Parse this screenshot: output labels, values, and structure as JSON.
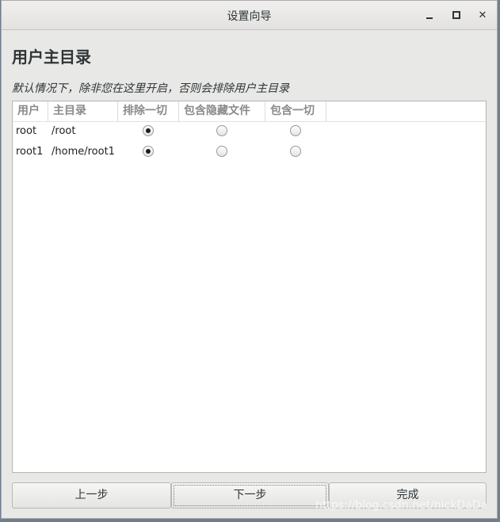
{
  "window": {
    "title": "设置向导"
  },
  "page": {
    "heading": "用户主目录",
    "description": "默认情况下，除非您在这里开启，否则会排除用户主目录"
  },
  "table": {
    "columns": [
      "用户",
      "主目录",
      "排除一切",
      "包含隐藏文件",
      "包含一切"
    ],
    "rows": [
      {
        "user": "root",
        "home": "/root",
        "selected": "exclude_all"
      },
      {
        "user": "root1",
        "home": "/home/root1",
        "selected": "exclude_all"
      }
    ]
  },
  "buttons": {
    "back": "上一步",
    "next": "下一步",
    "finish": "完成"
  },
  "watermark": "https://blog.csdn.net/nickDaDa"
}
